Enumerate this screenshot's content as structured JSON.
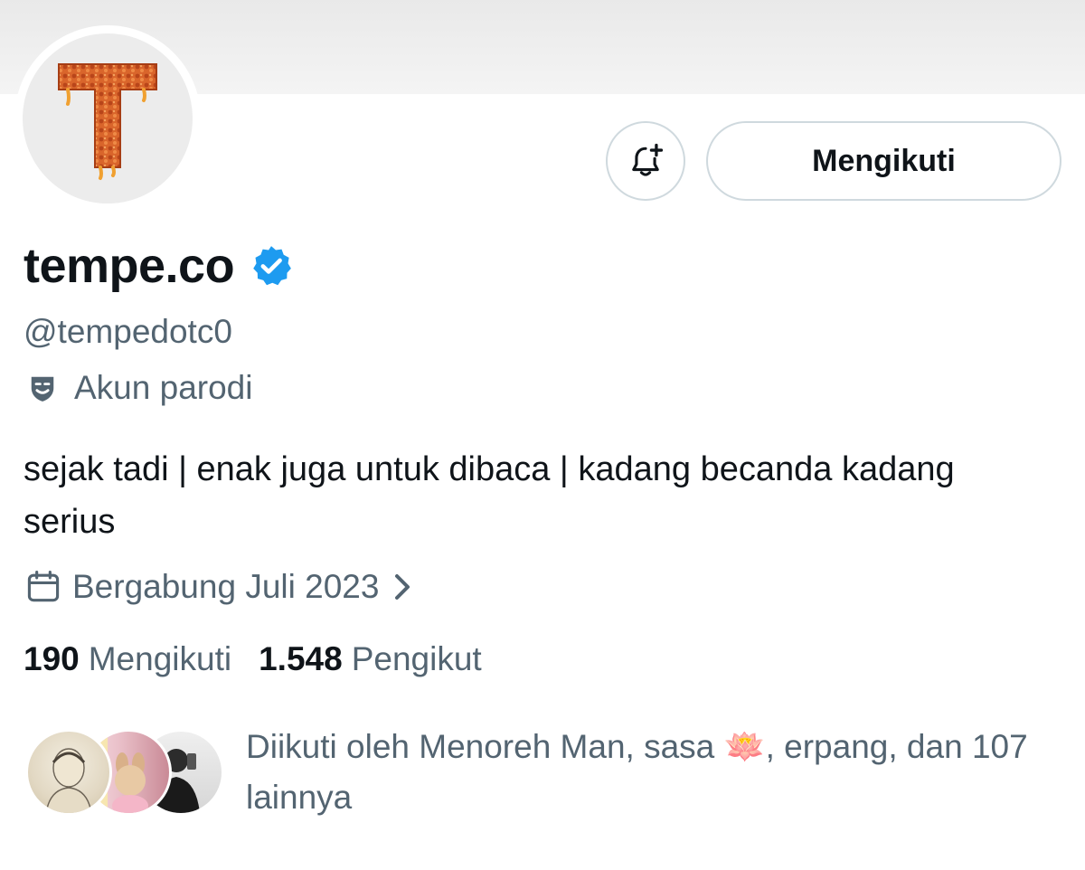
{
  "profile": {
    "display_name": "tempe.co",
    "handle": "@tempedotc0",
    "parody_label": "Akun parodi",
    "bio": "sejak tadi | enak juga untuk dibaca | kadang becanda kadang serius",
    "joined": "Bergabung Juli 2023",
    "avatar_letter": "T"
  },
  "actions": {
    "follow_label": "Mengikuti",
    "notify_icon": "bell-plus-icon"
  },
  "stats": {
    "following_count": "190",
    "following_label": "Mengikuti",
    "followers_count": "1.548",
    "followers_label": "Pengikut"
  },
  "followed_by": {
    "text": "Diikuti oleh Menoreh Man, sasa 🪷, erpang, dan 107 lainnya"
  },
  "colors": {
    "primary_text": "#0f1419",
    "secondary_text": "#536471",
    "verified": "#1d9bf0",
    "border": "#cfd9de",
    "avatar_letter": "#d9652b"
  },
  "icons": [
    "verified-badge-icon",
    "parody-mask-icon",
    "calendar-icon",
    "chevron-right-icon",
    "bell-plus-icon"
  ]
}
